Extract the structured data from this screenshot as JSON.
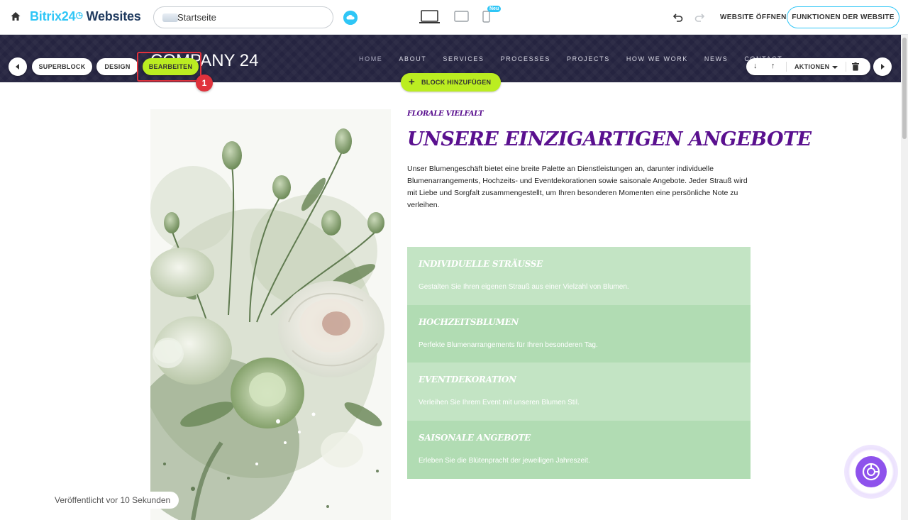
{
  "topbar": {
    "logo_part1": "Bitrix24",
    "logo_clock": "Ⓞ",
    "logo_part2": " Websites",
    "page_select_value": "Startseite",
    "new_badge": "Neu",
    "open_site_label": "WEBSITE ÖFFNEN",
    "features_label": "FUNKTIONEN DER WEBSITE"
  },
  "site": {
    "company_title": "COMPANY 24",
    "nav_items": [
      "HOME",
      "ABOUT",
      "SERVICES",
      "PROCESSES",
      "PROJECTS",
      "HOW WE WORK",
      "NEWS",
      "CONTACT"
    ]
  },
  "block_toolbar": {
    "superblock_label": "SUPERBLOCK",
    "design_label": "DESIGN",
    "edit_label": "BEARBEITEN",
    "step_number": "1",
    "actions_label": "AKTIONEN",
    "add_block_label": "BLOCK HINZUFÜGEN"
  },
  "content": {
    "eyebrow": "FLORALE VIELFALT",
    "heading": "UNSERE EINZIGARTIGEN ANGEBOTE",
    "intro": "Unser Blumengeschäft bietet eine breite Palette an Dienstleistungen an, darunter individuelle Blumenarrangements, Hochzeits- und Eventdekorationen sowie saisonale Angebote. Jeder Strauß wird mit Liebe und Sorgfalt zusammengestellt, um Ihren besonderen Momenten eine persönliche Note zu verleihen.",
    "services": [
      {
        "title": "INDIVIDUELLE STRÄUSSE",
        "desc": "Gestalten Sie Ihren eigenen Strauß aus einer Vielzahl von Blumen.",
        "color": "#c3e4c4"
      },
      {
        "title": "HOCHZEITSBLUMEN",
        "desc": "Perfekte Blumenarrangements für Ihren besonderen Tag.",
        "color": "#b1dcb3"
      },
      {
        "title": "EVENTDEKORATION",
        "desc": "Verleihen Sie Ihrem Event mit unseren Blumen Stil.",
        "color": "#c3e4c4"
      },
      {
        "title": "SAISONALE ANGEBOTE",
        "desc": "Erleben Sie die Blütenpracht der jeweiligen Jahreszeit.",
        "color": "#b1dcb3"
      }
    ]
  },
  "status": {
    "published": "Veröffentlicht vor 10 Sekunden"
  },
  "colors": {
    "accent_blue": "#2fc6f6",
    "accent_green": "#bbed21",
    "header_dark": "#252440",
    "heading_purple": "#5a108f",
    "highlight_red": "#e0323c"
  }
}
